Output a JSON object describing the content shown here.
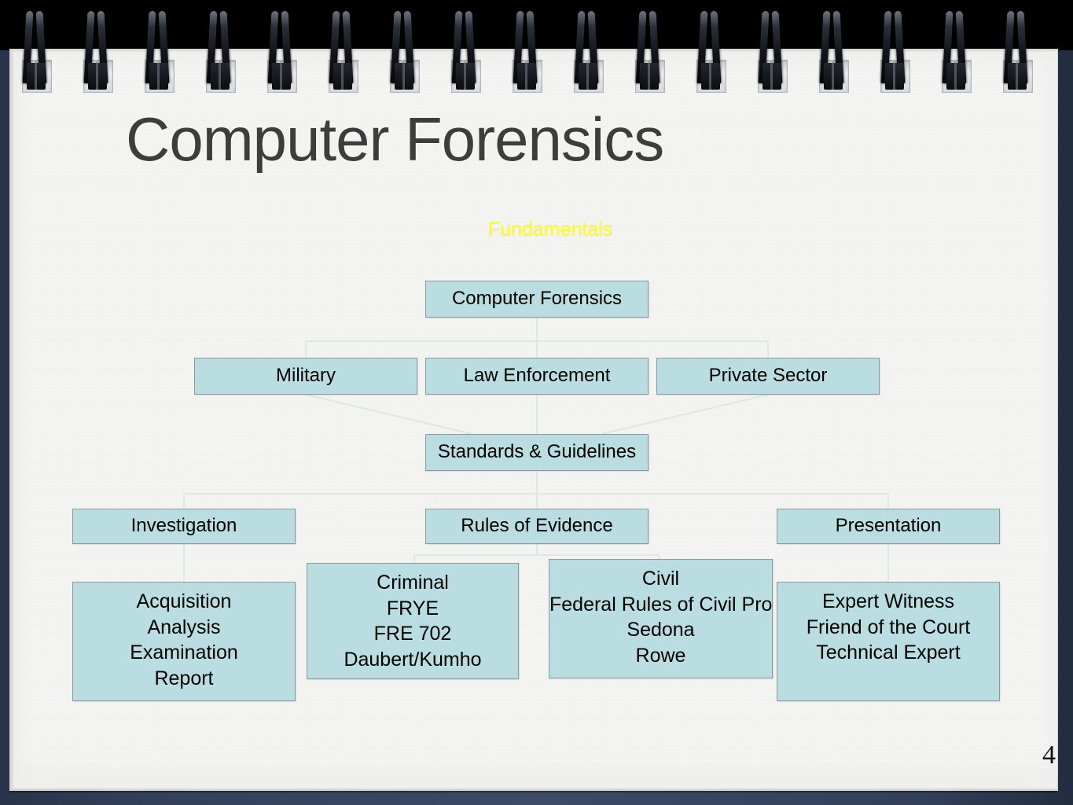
{
  "slide": {
    "title": "Computer Forensics",
    "subtitle": "Fundamentals",
    "page_number": "4",
    "colors": {
      "node_fill": "#b9dde0",
      "node_border": "#8a9a9c",
      "subtitle": "#ffff22",
      "title": "#3d3d3d",
      "background": "#33405a",
      "paper": "#f4f4f2",
      "spiral_band": "#000000"
    }
  },
  "chart_data": {
    "type": "diagram",
    "title": "Computer Forensics Fundamentals",
    "nodes": [
      {
        "id": "root",
        "label": "Computer Forensics",
        "lines": [
          "Computer Forensics"
        ],
        "level": 0,
        "clipped": true
      },
      {
        "id": "military",
        "label": "Military",
        "lines": [
          "Military"
        ],
        "level": 1,
        "clipped": false
      },
      {
        "id": "law",
        "label": "Law Enforcement",
        "lines": [
          "Law Enforcement"
        ],
        "level": 1,
        "clipped": true
      },
      {
        "id": "private",
        "label": "Private Sector",
        "lines": [
          "Private Sector"
        ],
        "level": 1,
        "clipped": false
      },
      {
        "id": "standards",
        "label": "Standards & Guidelines",
        "lines": [
          "Standards & Guidelines"
        ],
        "level": 2,
        "clipped": true
      },
      {
        "id": "investigation",
        "label": "Investigation",
        "lines": [
          "Investigation"
        ],
        "level": 3,
        "clipped": false
      },
      {
        "id": "rules",
        "label": "Rules of Evidence",
        "lines": [
          "Rules of Evidence"
        ],
        "level": 3,
        "clipped": true
      },
      {
        "id": "presentation",
        "label": "Presentation",
        "lines": [
          "Presentation"
        ],
        "level": 3,
        "clipped": false
      },
      {
        "id": "acquisition",
        "label": "Acquisition / Analysis / Examination / Report",
        "lines": [
          "Acquisition",
          "Analysis",
          "Examination",
          "Report"
        ],
        "level": 4,
        "clipped": false
      },
      {
        "id": "criminal",
        "label": "Criminal / FRYE / FRE 702 / Daubert/Kumho",
        "lines": [
          "Criminal",
          "FRYE",
          "FRE 702",
          "Daubert/Kumho"
        ],
        "level": 4,
        "clipped": false
      },
      {
        "id": "civil",
        "label": "Civil / Federal Rules of Civil Procedure / Sedona / Rowe",
        "lines": [
          "Civil",
          "Federal Rules of Civil Procedure",
          "Sedona",
          "Rowe"
        ],
        "level": 4,
        "clipped": true
      },
      {
        "id": "expert",
        "label": "Expert Witness / Friend of the Court / Technical Expert",
        "lines": [
          "Expert Witness",
          "Friend of the Court",
          "Technical Expert"
        ],
        "level": 4,
        "clipped": true
      }
    ],
    "edges": [
      {
        "from": "root",
        "to": "military"
      },
      {
        "from": "root",
        "to": "law"
      },
      {
        "from": "root",
        "to": "private"
      },
      {
        "from": "military",
        "to": "standards"
      },
      {
        "from": "law",
        "to": "standards"
      },
      {
        "from": "private",
        "to": "standards"
      },
      {
        "from": "standards",
        "to": "investigation"
      },
      {
        "from": "standards",
        "to": "rules"
      },
      {
        "from": "standards",
        "to": "presentation"
      },
      {
        "from": "investigation",
        "to": "acquisition"
      },
      {
        "from": "rules",
        "to": "criminal"
      },
      {
        "from": "rules",
        "to": "civil"
      },
      {
        "from": "presentation",
        "to": "expert"
      }
    ]
  }
}
